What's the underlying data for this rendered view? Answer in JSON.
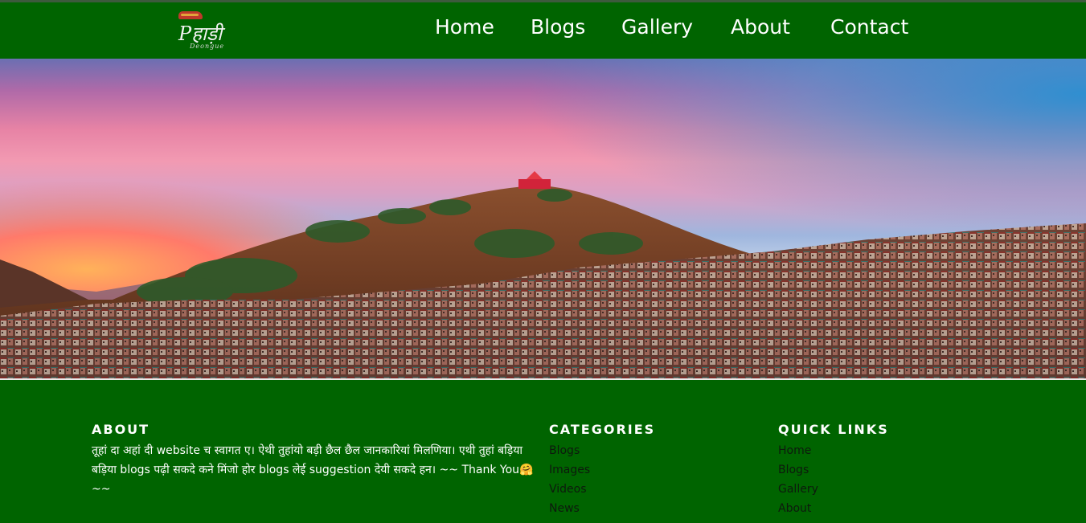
{
  "header": {
    "logo": {
      "script_text": "Pहाड़ी",
      "sub_text": "Deongue"
    },
    "nav": [
      {
        "label": "Home"
      },
      {
        "label": "Blogs"
      },
      {
        "label": "Gallery"
      },
      {
        "label": "About"
      },
      {
        "label": "Contact"
      }
    ]
  },
  "hero": {
    "image": "town-on-hill-at-sunset"
  },
  "footer": {
    "about": {
      "heading": "ABOUT",
      "text": "तूहां दा अहां दी website च स्वागत ए। ऐथी तुहांयो बड़ी छैल छैल जानकारियां मिलणिया। एथी तुहां बड़िया बड़िया blogs पढ़ी सकदे कने मिंजो होर blogs लेई suggestion देयी सकदे हन। ~~ Thank You🤗 ~~"
    },
    "categories": {
      "heading": "CATEGORIES",
      "items": [
        "Blogs",
        "Images",
        "Videos",
        "News"
      ]
    },
    "quick_links": {
      "heading": "QUICK LINKS",
      "items": [
        "Home",
        "Blogs",
        "Gallery",
        "About"
      ]
    }
  },
  "colors": {
    "brand_green": "#006400",
    "text_light": "#ffffff",
    "text_dark": "#0d1a0d"
  }
}
